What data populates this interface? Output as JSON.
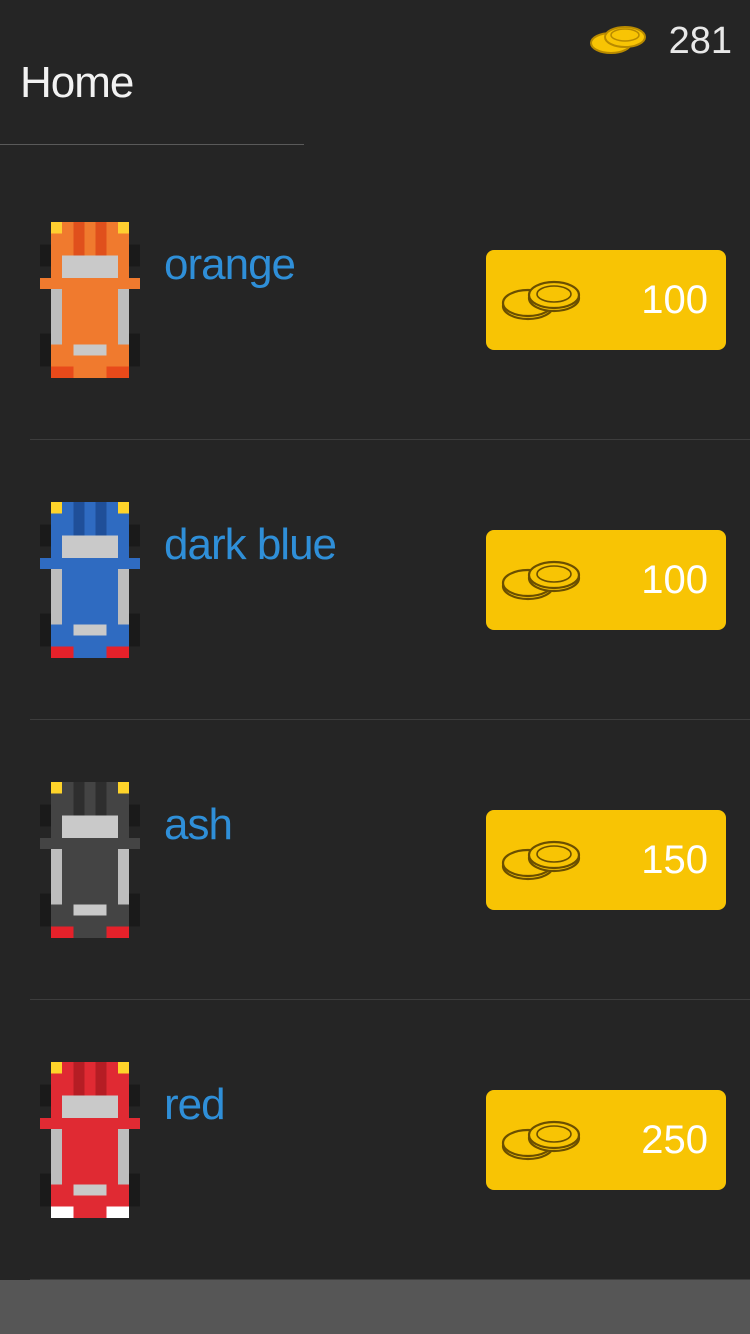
{
  "header": {
    "title": "Home"
  },
  "wallet": {
    "coins": "281",
    "icon": "coins-icon"
  },
  "cars": [
    {
      "name": "orange",
      "price": "100",
      "body": "#f07a2e",
      "dark": "#e0501c",
      "accent": "#ffcf30",
      "rear": "#e84a1a"
    },
    {
      "name": "dark blue",
      "price": "100",
      "body": "#2f6bc1",
      "dark": "#1f4f99",
      "accent": "#ffd42a",
      "rear": "#e5212a"
    },
    {
      "name": "ash",
      "price": "150",
      "body": "#444444",
      "dark": "#2e2e2e",
      "accent": "#ffd42a",
      "rear": "#e5212a"
    },
    {
      "name": "red",
      "price": "250",
      "body": "#e02a33",
      "dark": "#b51d24",
      "accent": "#ffd42a",
      "rear": "#ffffff"
    }
  ],
  "colors": {
    "button": "#f8c404",
    "name_text": "#2f8fd8",
    "background": "#252525"
  }
}
